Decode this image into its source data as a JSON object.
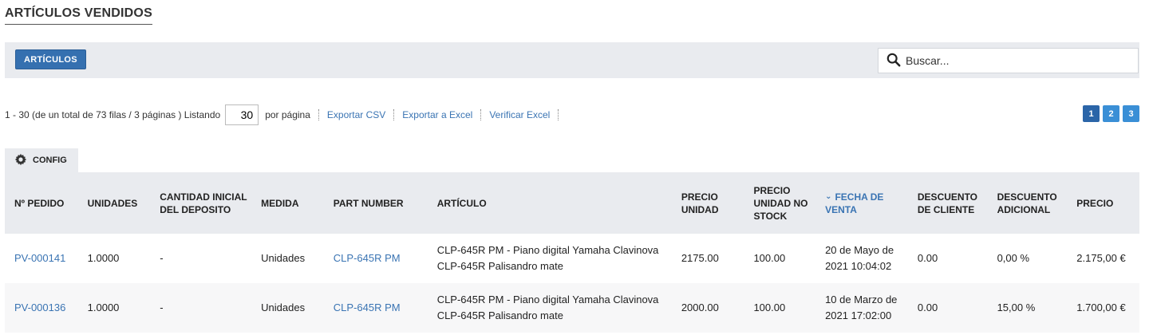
{
  "page": {
    "title": "ARTÍCULOS VENDIDOS"
  },
  "toolbar": {
    "articulos_label": "ARTÍCULOS",
    "search_placeholder": "Buscar..."
  },
  "pager": {
    "summary": "1 - 30 (de un total de 73 filas / 3 páginas ) Listando",
    "per_page_value": "30",
    "per_page_label": "por página",
    "export_csv": "Exportar CSV",
    "export_excel": "Exportar a Excel",
    "verify_excel": "Verificar Excel",
    "pages": [
      "1",
      "2",
      "3"
    ],
    "current_page": "1"
  },
  "config": {
    "label": "CONFIG"
  },
  "table": {
    "headers": {
      "pedido": "Nº PEDIDO",
      "unidades": "UNIDADES",
      "cantidad": "CANTIDAD INICIAL DEL DEPOSITO",
      "medida": "MEDIDA",
      "part": "PART NUMBER",
      "articulo": "ARTÍCULO",
      "precio_unidad": "PRECIO UNIDAD",
      "precio_nostock": "PRECIO UNIDAD NO STOCK",
      "fecha": "FECHA DE VENTA",
      "desc_cliente": "DESCUENTO DE CLIENTE",
      "desc_adicional": "DESCUENTO ADICIONAL",
      "precio": "PRECIO"
    },
    "sort_indicator": "⌄",
    "rows": [
      {
        "pedido": "PV-000141",
        "unidades": "1.0000",
        "cantidad": "-",
        "medida": "Unidades",
        "part": "CLP-645R PM",
        "articulo": "CLP-645R PM - Piano digital Yamaha Clavinova CLP-645R Palisandro mate",
        "precio_unidad": "2175.00",
        "precio_nostock": "100.00",
        "fecha": "20 de Mayo de 2021 10:04:02",
        "desc_cliente": "0.00",
        "desc_adicional": "0,00 %",
        "precio": "2.175,00 €"
      },
      {
        "pedido": "PV-000136",
        "unidades": "1.0000",
        "cantidad": "-",
        "medida": "Unidades",
        "part": "CLP-645R PM",
        "articulo": "CLP-645R PM - Piano digital Yamaha Clavinova CLP-645R Palisandro mate",
        "precio_unidad": "2000.00",
        "precio_nostock": "100.00",
        "fecha": "10 de Marzo de 2021 17:02:00",
        "desc_cliente": "0.00",
        "desc_adicional": "15,00 %",
        "precio": "1.700,00 €"
      }
    ]
  },
  "colors": {
    "accent": "#3570b0",
    "link": "#3a74b3",
    "toolbar_bg": "#e9ebef",
    "page_button": "#3a8fd6"
  }
}
